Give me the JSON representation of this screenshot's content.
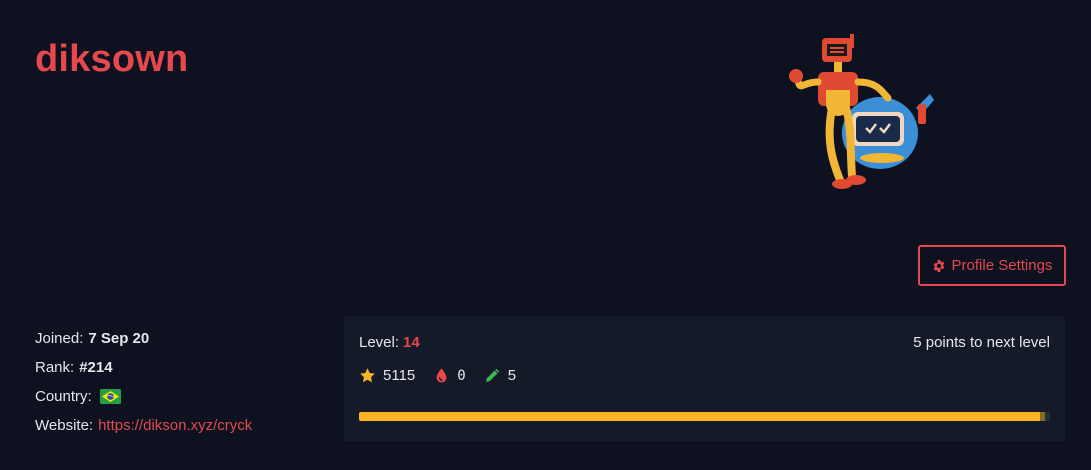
{
  "profile": {
    "username": "diksown",
    "settings_label": "Profile Settings"
  },
  "info": {
    "joined_label": "Joined:",
    "joined_value": "7 Sep 20",
    "rank_label": "Rank:",
    "rank_value": "#214",
    "country_label": "Country:",
    "country_flag": "brazil-flag-icon",
    "website_label": "Website:",
    "website_url": "https://dikson.xyz/cryck"
  },
  "level": {
    "label": "Level:",
    "value": "14",
    "next_text": "5 points to next level",
    "progress_fraction": 0.993
  },
  "stats": {
    "points": "5115",
    "first_bloods": "0",
    "writeups": "5"
  },
  "colors": {
    "accent": "#e5484d",
    "background": "#0d1120",
    "card": "#151a29",
    "progress": "#fbb424",
    "star": "#fbb424",
    "blood": "#e5484d",
    "pencil": "#3fb950"
  }
}
